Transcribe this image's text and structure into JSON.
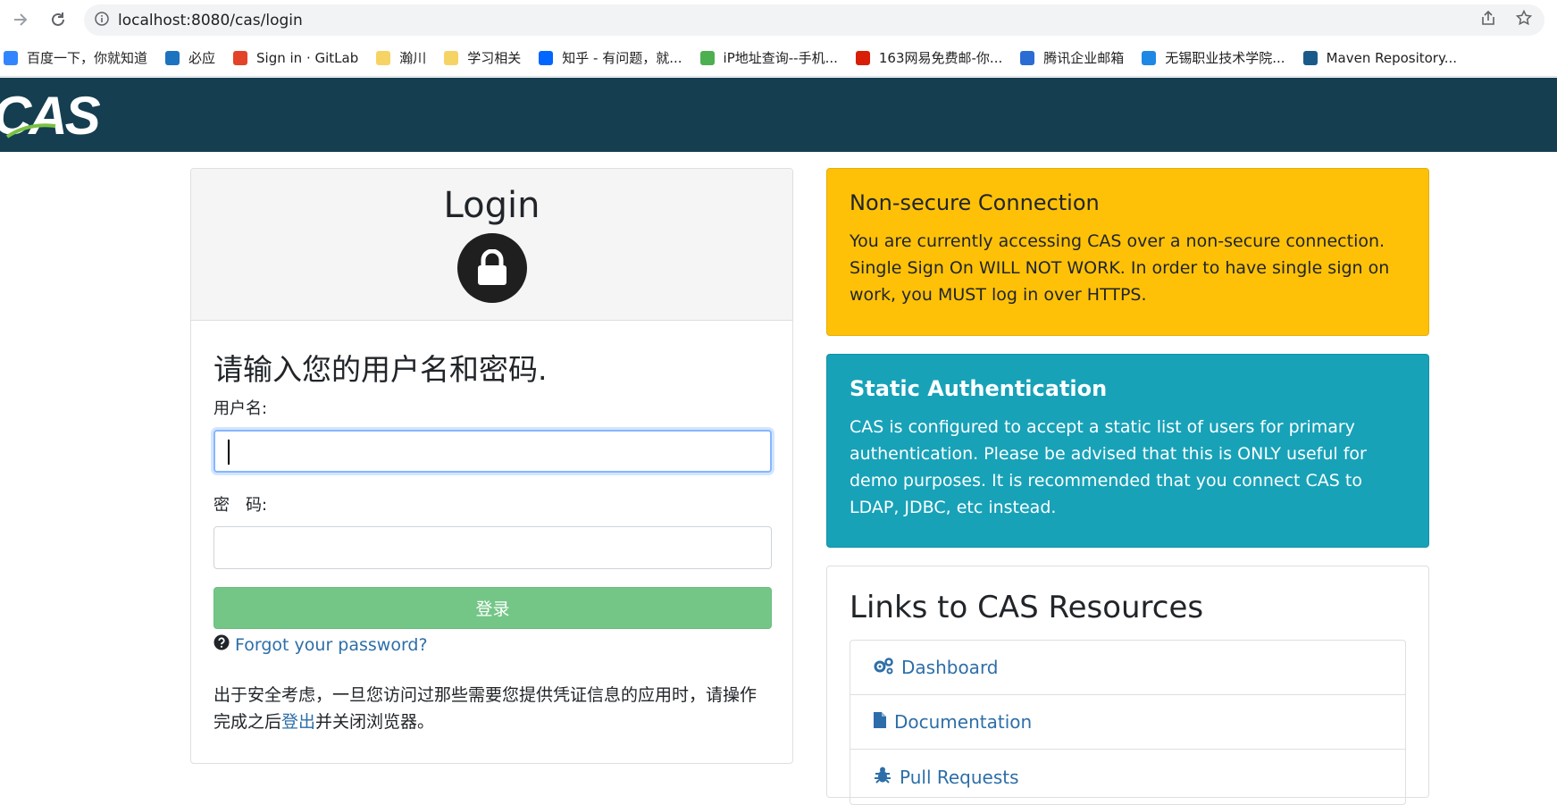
{
  "browser": {
    "url": "localhost:8080/cas/login",
    "bookmarks": [
      {
        "icon": "baidu-icon",
        "label": "百度一下，你就知道",
        "color": "#3385ff"
      },
      {
        "icon": "bing-search-icon",
        "label": "必应",
        "color": "#1e73be"
      },
      {
        "icon": "gitlab-icon",
        "label": "Sign in · GitLab",
        "color": "#e24329"
      },
      {
        "icon": "folder-icon",
        "label": "瀚川",
        "color": "#f6d365"
      },
      {
        "icon": "folder-icon",
        "label": "学习相关",
        "color": "#f6d365"
      },
      {
        "icon": "zhihu-icon",
        "label": "知乎 - 有问题，就...",
        "color": "#0066ff"
      },
      {
        "icon": "ip-lookup-icon",
        "label": "iP地址查询--手机...",
        "color": "#4caf50"
      },
      {
        "icon": "netease-icon",
        "label": "163网易免费邮-你...",
        "color": "#d81e06"
      },
      {
        "icon": "tencent-mail-icon",
        "label": "腾讯企业邮箱",
        "color": "#2b6cd4"
      },
      {
        "icon": "monitor-icon",
        "label": "无锡职业技术学院...",
        "color": "#1e88e5"
      },
      {
        "icon": "maven-icon",
        "label": "Maven Repository...",
        "color": "#1a5a8a"
      }
    ]
  },
  "header": {
    "logo_text": "CAS"
  },
  "login": {
    "title": "Login",
    "prompt": "请输入您的用户名和密码.",
    "username_label": "用户名:",
    "password_label": "密　码:",
    "submit_label": "登录",
    "forgot_label": "Forgot your password?",
    "notice_before": "出于安全考虑，一旦您访问过那些需要您提供凭证信息的应用时，请操作完成之后",
    "notice_link": "登出",
    "notice_after": "并关闭浏览器。"
  },
  "warning": {
    "title": "Non-secure Connection",
    "text": "You are currently accessing CAS over a non-secure connection. Single Sign On WILL NOT WORK. In order to have single sign on work, you MUST log in over HTTPS."
  },
  "static_auth": {
    "title": "Static Authentication",
    "text": "CAS is configured to accept a static list of users for primary authentication. Please be advised that this is ONLY useful for demo purposes. It is recommended that you connect CAS to LDAP, JDBC, etc instead."
  },
  "resources": {
    "title": "Links to CAS Resources",
    "links": [
      {
        "icon": "gears-icon",
        "label": "Dashboard"
      },
      {
        "icon": "document-icon",
        "label": "Documentation"
      },
      {
        "icon": "bug-icon",
        "label": "Pull Requests"
      }
    ]
  },
  "colors": {
    "header_bg": "#153e50",
    "warning_bg": "#ffc107",
    "info_bg": "#17a2b8",
    "submit_bg": "#74c687",
    "link": "#2d6ea8"
  }
}
